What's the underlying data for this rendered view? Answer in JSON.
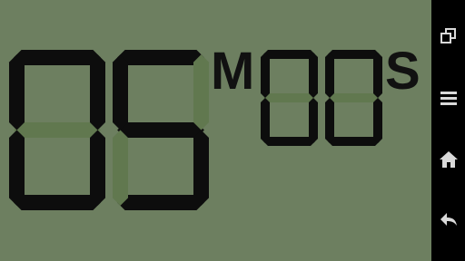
{
  "timer": {
    "minutes": "05",
    "seconds": "00",
    "minutes_unit": "M",
    "seconds_unit": "S"
  },
  "colors": {
    "lcd_background": "#6d7f60",
    "segment_on": "#0d0d0d",
    "segment_ghost": "#61784f",
    "navbar_background": "#000000",
    "navbar_icon": "#d9d9d9"
  },
  "navbar": {
    "buttons": [
      {
        "icon": "recent-apps-icon"
      },
      {
        "icon": "menu-icon"
      },
      {
        "icon": "home-icon"
      },
      {
        "icon": "back-icon"
      }
    ]
  }
}
